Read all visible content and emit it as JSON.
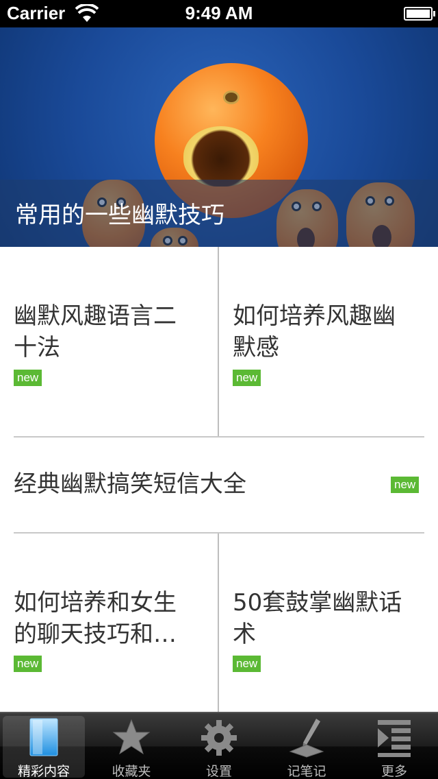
{
  "status_bar": {
    "carrier": "Carrier",
    "time": "9:49 AM"
  },
  "hero": {
    "caption": "常用的一些幽默技巧"
  },
  "tiles": [
    {
      "title_line1": "幽默风趣语言二",
      "title_line2": "十法",
      "badge": "new"
    },
    {
      "title_line1": "如何培养风趣幽",
      "title_line2": "默感",
      "badge": "new"
    },
    {
      "title_line1": "经典幽默搞笑短信大全",
      "badge": "new"
    },
    {
      "title_line1": "如何培养和女生",
      "title_line2": "的聊天技巧和…",
      "badge": "new"
    },
    {
      "title_line1": "50套鼓掌幽默话",
      "title_line2": "术",
      "badge": "new"
    }
  ],
  "tab_bar": {
    "tabs": [
      {
        "label": "精彩内容",
        "icon": "page-icon",
        "active": true
      },
      {
        "label": "收藏夹",
        "icon": "star-icon"
      },
      {
        "label": "设置",
        "icon": "gear-icon"
      },
      {
        "label": "记笔记",
        "icon": "pen-icon"
      },
      {
        "label": "更多",
        "icon": "more-list-icon"
      }
    ]
  },
  "colors": {
    "badge_green": "#5bb934",
    "divider": "#c8c8c8"
  }
}
